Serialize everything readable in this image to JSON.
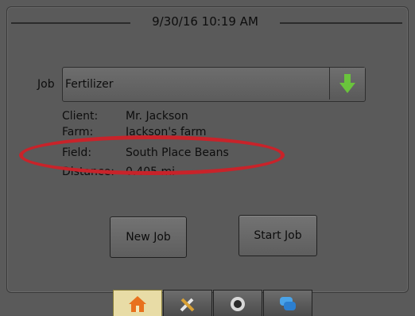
{
  "header": {
    "datetime": "9/30/16 10:19 AM"
  },
  "job": {
    "label": "Job",
    "selected": "Fertilizer"
  },
  "details": {
    "client_label": "Client:",
    "client_value": "Mr. Jackson",
    "farm_label": "Farm:",
    "farm_value": "Jackson's farm",
    "field_label": "Field:",
    "field_value": "South Place Beans",
    "distance_label": "Distance:",
    "distance_value": "0.405 mi"
  },
  "buttons": {
    "new_job": "New Job",
    "start_job": "Start Job"
  },
  "tabs": [
    {
      "icon": "home-icon",
      "selected": true
    },
    {
      "icon": "tools-icon",
      "selected": false
    },
    {
      "icon": "sensor-icon",
      "selected": false
    },
    {
      "icon": "chat-icon",
      "selected": false
    }
  ],
  "colors": {
    "highlight_ellipse": "#c8232a",
    "arrow_green": "#6ac43c"
  }
}
